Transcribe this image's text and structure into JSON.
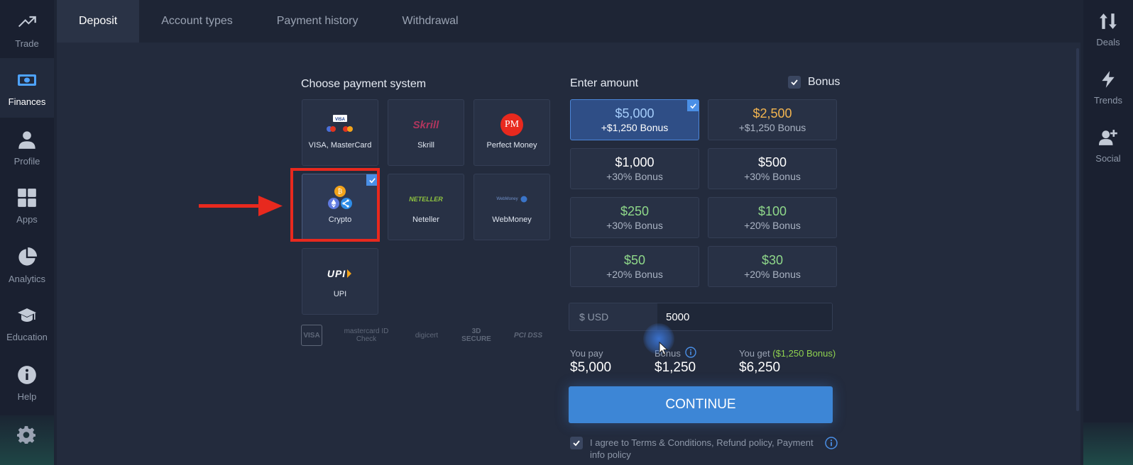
{
  "left_nav": [
    {
      "label": "Trade",
      "icon": "trend-up-icon"
    },
    {
      "label": "Finances",
      "icon": "wallet-icon",
      "active": true
    },
    {
      "label": "Profile",
      "icon": "user-icon"
    },
    {
      "label": "Apps",
      "icon": "grid-icon"
    },
    {
      "label": "Analytics",
      "icon": "pie-chart-icon"
    },
    {
      "label": "Education",
      "icon": "graduation-cap-icon"
    },
    {
      "label": "Help",
      "icon": "info-icon"
    }
  ],
  "right_nav": [
    {
      "label": "Deals",
      "icon": "sort-arrows-icon"
    },
    {
      "label": "Trends",
      "icon": "lightning-icon"
    },
    {
      "label": "Social",
      "icon": "add-user-icon"
    }
  ],
  "tabs": [
    "Deposit",
    "Account types",
    "Payment history",
    "Withdrawal"
  ],
  "payment": {
    "title": "Choose payment system",
    "methods": [
      {
        "name": "VISA, MasterCard"
      },
      {
        "name": "Skrill"
      },
      {
        "name": "Perfect Money"
      },
      {
        "name": "Crypto",
        "selected": true
      },
      {
        "name": "Neteller"
      },
      {
        "name": "WebMoney"
      },
      {
        "name": "UPI"
      }
    ],
    "logos": {
      "visa": "VISA",
      "skrill": "Skrill",
      "pm": "PM",
      "neteller": "NETELLER",
      "webmoney": "WebMoney",
      "upi": "UPI"
    }
  },
  "trust": [
    "VISA",
    "mastercard ID Check",
    "digicert",
    "3D SECURE",
    "PCI DSS"
  ],
  "amount": {
    "title": "Enter amount",
    "bonus_label": "Bonus",
    "options": [
      {
        "amount": "$5,000",
        "bonus": "+$1,250 Bonus",
        "selected": true
      },
      {
        "amount": "$2,500",
        "bonus": "+$1,250 Bonus"
      },
      {
        "amount": "$1,000",
        "bonus": "+30% Bonus"
      },
      {
        "amount": "$500",
        "bonus": "+30% Bonus"
      },
      {
        "amount": "$250",
        "bonus": "+30% Bonus"
      },
      {
        "amount": "$100",
        "bonus": "+20% Bonus"
      },
      {
        "amount": "$50",
        "bonus": "+20% Bonus"
      },
      {
        "amount": "$30",
        "bonus": "+20% Bonus"
      }
    ],
    "currency": "$ USD",
    "value": "5000"
  },
  "summary": {
    "you_pay_label": "You pay",
    "you_pay": "$5,000",
    "bonus_label": "Bonus",
    "bonus": "$1,250",
    "you_get_label": "You get",
    "you_get_extra": "($1,250 Bonus)",
    "you_get": "$6,250"
  },
  "continue_label": "CONTINUE",
  "agree_text": "I agree to Terms & Conditions, Refund policy, Payment info policy",
  "colors": {
    "accent": "#3d86d6",
    "highlight": "#e8291e",
    "amount_gold": "#f2b450",
    "amount_green": "#8fd88a",
    "bonus_green": "#8fd14f"
  }
}
